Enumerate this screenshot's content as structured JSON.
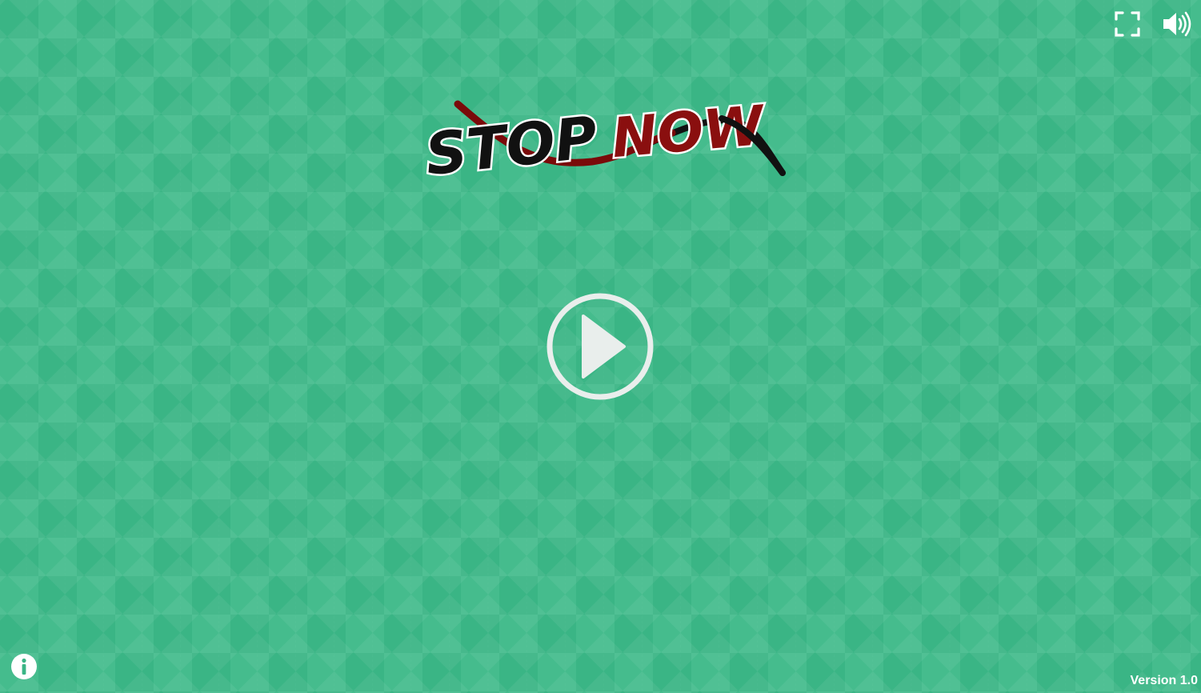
{
  "game": {
    "logo_word_1": "STOP",
    "logo_word_2": "NOW"
  },
  "version_label": "Version 1.0",
  "icons": {
    "fullscreen": "fullscreen-icon",
    "sound": "speaker-volume-icon",
    "info": "info-icon",
    "play": "play-icon"
  },
  "colors": {
    "background": "#3ab585",
    "background_light": "#45bc8d",
    "logo_stop_fill": "#111111",
    "logo_now_fill": "#8a0f0f",
    "rope_dark": "#111111",
    "rope_red": "#7a0a0a",
    "ui_white": "#ffffff",
    "play_ring": "#e9eeec"
  }
}
